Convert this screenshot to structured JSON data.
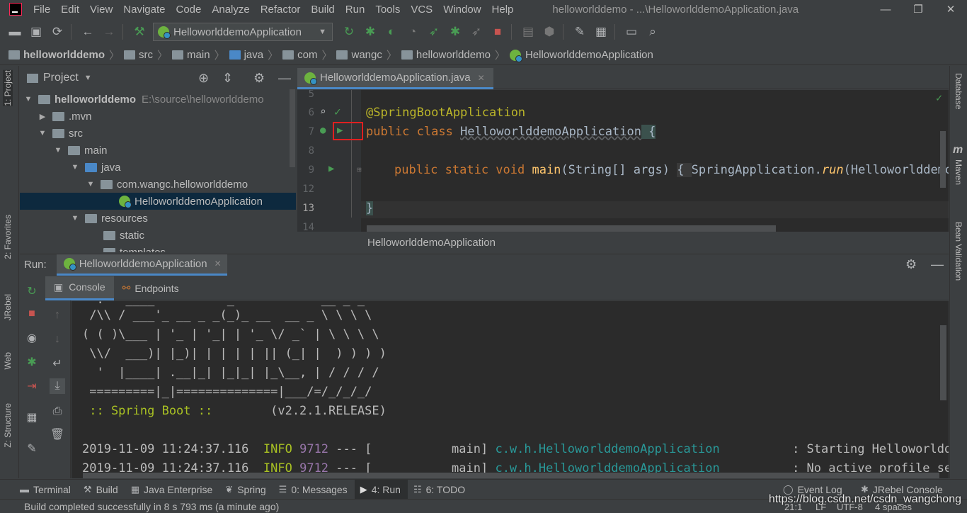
{
  "menu": {
    "items": [
      "File",
      "Edit",
      "View",
      "Navigate",
      "Code",
      "Analyze",
      "Refactor",
      "Build",
      "Run",
      "Tools",
      "VCS",
      "Window",
      "Help"
    ],
    "window_title": "helloworlddemo - ...\\HelloworlddemoApplication.java",
    "minimize": "—",
    "restore": "❐",
    "close": "✕"
  },
  "toolbar": {
    "run_config": "HelloworlddemoApplication"
  },
  "breadcrumb": [
    "helloworlddemo",
    "src",
    "main",
    "java",
    "com",
    "wangc",
    "helloworlddemo",
    "HelloworlddemoApplication"
  ],
  "left_stripe": {
    "project": "1: Project",
    "favorites": "2: Favorites",
    "jrebel": "JRebel",
    "web": "Web",
    "structure": "Z: Structure"
  },
  "right_stripe": {
    "database": "Database",
    "maven": "Maven",
    "bean_validation": "Bean Validation"
  },
  "project_panel": {
    "title": "Project",
    "tree": [
      {
        "label": "helloworlddemo",
        "path": "E:\\source\\helloworlddemo"
      },
      {
        "label": ".mvn"
      },
      {
        "label": "src"
      },
      {
        "label": "main"
      },
      {
        "label": "java"
      },
      {
        "label": "com.wangc.helloworlddemo"
      },
      {
        "label": "HelloworlddemoApplication"
      },
      {
        "label": "resources"
      },
      {
        "label": "static"
      },
      {
        "label": "templates"
      }
    ]
  },
  "editor": {
    "tab": "HelloworlddemoApplication.java",
    "line_numbers": [
      "5",
      "6",
      "7",
      "8",
      "9",
      "12",
      "13",
      "14"
    ],
    "code": {
      "l6": "@SpringBootApplication",
      "l7_kw": "public class ",
      "l7_name": "HelloworlddemoApplication",
      "l7_brace": " {",
      "l9_kw": "public static void ",
      "l9_fn": "main",
      "l9_args": "(String[] args) ",
      "l9_brace": "{ ",
      "l9_body": "SpringApplication.",
      "l9_run": "run",
      "l9_rest": "(HelloworlddemoAp",
      "l13": "}"
    },
    "status": "HelloworlddemoApplication"
  },
  "run_panel": {
    "label": "Run:",
    "tab": "HelloworlddemoApplication",
    "subtabs": [
      "Console",
      "Endpoints"
    ],
    "banner": [
      "  .   ____          _            __ _ _",
      " /\\\\ / ___'_ __ _ _(_)_ __  __ _ \\ \\ \\ \\",
      "( ( )\\___ | '_ | '_| | '_ \\/ _` | \\ \\ \\ \\",
      " \\\\/  ___)| |_)| | | | | || (_| |  ) ) ) )",
      "  '  |____| .__|_| |_|_| |_\\__, | / / / /",
      " =========|_|==============|___/=/_/_/_/"
    ],
    "spring_boot_label": " :: Spring Boot :: ",
    "spring_boot_version": "       (v2.2.1.RELEASE)",
    "log": [
      {
        "time": "2019-11-09 11:24:37.116",
        "level": "INFO",
        "pid": "9712",
        "mid": " --- [           main] ",
        "cls": "c.w.h.HelloworlddemoApplication",
        "msg": "          : Starting Helloworlddemo"
      },
      {
        "time": "2019-11-09 11:24:37.116",
        "level": "INFO",
        "pid": "9712",
        "mid": " --- [           main] ",
        "cls": "c.w.h.HelloworlddemoApplication",
        "msg": "          : No active profile set,"
      }
    ]
  },
  "bottom_tabs": [
    {
      "label": "Terminal"
    },
    {
      "label": "Build"
    },
    {
      "label": "Java Enterprise"
    },
    {
      "label": "Spring"
    },
    {
      "label": "0: Messages"
    },
    {
      "label": "4: Run"
    },
    {
      "label": "6: TODO"
    }
  ],
  "bottom_right_tabs": [
    "Event Log",
    "JRebel Console"
  ],
  "status": {
    "message": "Build completed successfully in 8 s 793 ms (a minute ago)",
    "position": "21:1",
    "line_sep": "LF",
    "encoding": "UTF-8",
    "indent": "4 spaces"
  },
  "watermark": "https://blog.csdn.net/csdn_wangchong",
  "colors": {
    "background": "#3c3f41",
    "editor_bg": "#2b2b2b",
    "keyword": "#cc7832",
    "annotation": "#bbb529",
    "function": "#ffc66d",
    "log_level": "#a8c023",
    "log_class": "#299999",
    "selection": "#0d293e",
    "highlight_box": "#e02020"
  }
}
